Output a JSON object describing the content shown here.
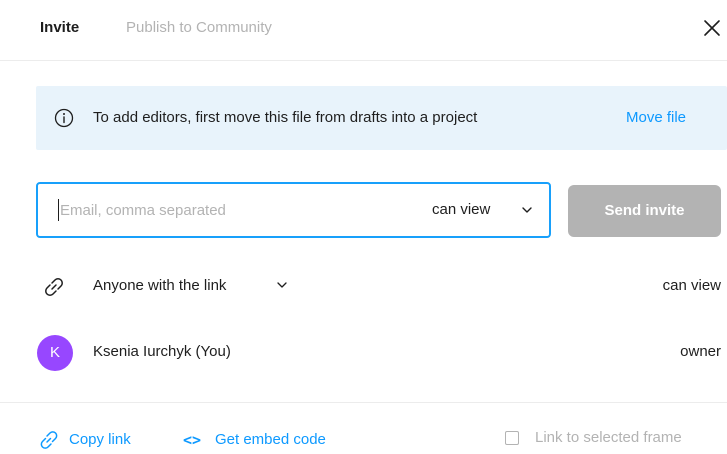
{
  "header": {
    "tabs": [
      {
        "label": "Invite",
        "active": true
      },
      {
        "label": "Publish to Community",
        "active": false
      }
    ]
  },
  "banner": {
    "icon": "info-icon",
    "text": "To add editors, first move this file from drafts into a project",
    "link_label": "Move file"
  },
  "invite": {
    "email_placeholder": "Email, comma separated",
    "email_value": "",
    "permission": "can view",
    "send_label": "Send invite"
  },
  "link_access": {
    "icon": "link-icon",
    "label": "Anyone with the link",
    "permission": "can view"
  },
  "members": [
    {
      "initial": "K",
      "name": "Ksenia Iurchyk (You)",
      "role": "owner",
      "avatar_color": "#9747ff"
    }
  ],
  "footer": {
    "copy_link_label": "Copy link",
    "embed_icon_glyph": "<>",
    "embed_label": "Get embed code",
    "frame_checkbox_label": "Link to selected frame",
    "frame_checked": false
  },
  "colors": {
    "accent": "#0d99ff",
    "focus_border": "#18a0fb",
    "banner_bg": "#e8f3fb",
    "disabled": "#b3b3b3"
  }
}
